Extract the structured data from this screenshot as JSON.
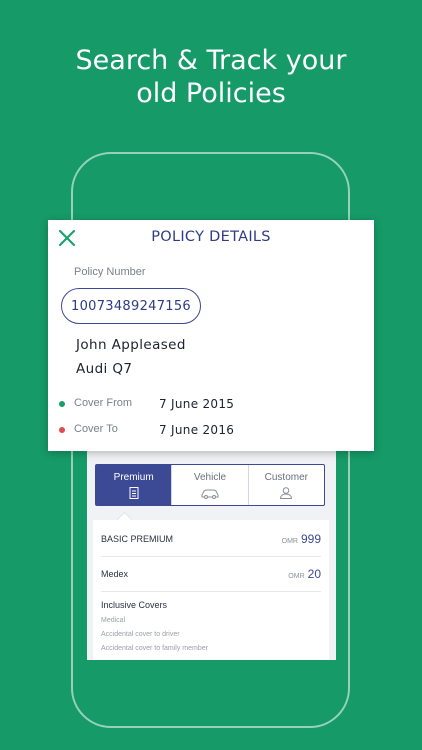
{
  "headline": {
    "line1": "Search & Track your",
    "line2": "old Policies"
  },
  "colors": {
    "background": "#169a68",
    "accent": "#3c4a95",
    "close_icon": "#1aa36f",
    "green_dot": "#18a06c",
    "red_dot": "#e24b4b"
  },
  "policy_details": {
    "title": "POLICY DETAILS",
    "close_icon": "close-icon",
    "policy_number_label": "Policy Number",
    "policy_number": "10073489247156",
    "customer_name": "John Appleased",
    "vehicle": "Audi Q7",
    "cover_from_label": "Cover From",
    "cover_from": "7 June 2015",
    "cover_to_label": "Cover To",
    "cover_to": "7 June 2016"
  },
  "tabs": [
    {
      "label": "Premium",
      "icon": "document-icon",
      "active": true
    },
    {
      "label": "Vehicle",
      "icon": "car-icon",
      "active": false
    },
    {
      "label": "Customer",
      "icon": "person-icon",
      "active": false
    }
  ],
  "premium": {
    "rows": [
      {
        "label": "BASIC PREMIUM",
        "currency": "OMR",
        "amount": "999"
      },
      {
        "label": "Medex",
        "currency": "OMR",
        "amount": "20"
      }
    ],
    "inclusive_title": "Inclusive Covers",
    "inclusive_items": [
      "Medical",
      "Accidental cover to driver",
      "Accidental cover to family member"
    ]
  }
}
